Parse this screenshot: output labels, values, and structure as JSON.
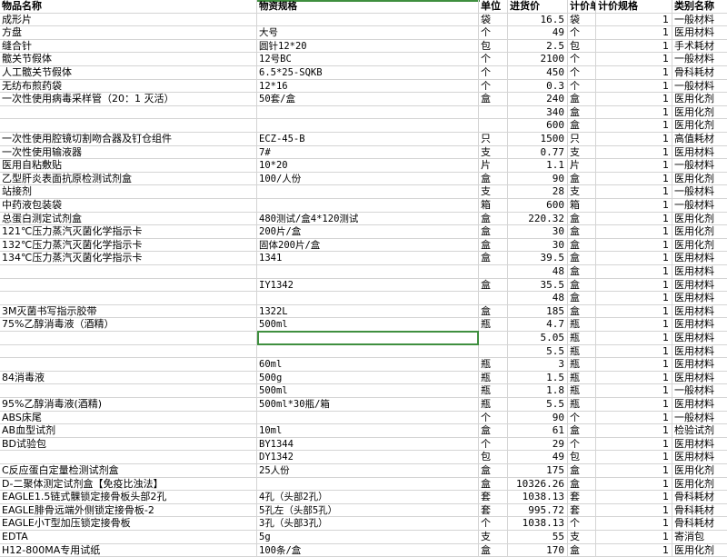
{
  "headers": {
    "name": "物品名称",
    "spec": "物资规格",
    "unit": "单位",
    "price": "进货价",
    "price_unit": "计价单位",
    "price_spec": "计价规格",
    "category": "类别名称"
  },
  "rows": [
    {
      "name": "成形片",
      "spec": "",
      "unit": "袋",
      "price": "16.5",
      "price_unit": "袋",
      "price_spec": "1",
      "category": "一般材料"
    },
    {
      "name": "方盘",
      "spec": "大号",
      "unit": "个",
      "price": "49",
      "price_unit": "个",
      "price_spec": "1",
      "category": "医用材料"
    },
    {
      "name": "缝合针",
      "spec": "圆针12*20",
      "unit": "包",
      "price": "2.5",
      "price_unit": "包",
      "price_spec": "1",
      "category": "手术耗材"
    },
    {
      "name": "髋关节假体",
      "spec": "12号BC",
      "unit": "个",
      "price": "2100",
      "price_unit": "个",
      "price_spec": "1",
      "category": "一般材料"
    },
    {
      "name": "人工髋关节假体",
      "spec": "6.5*25-SQKB",
      "unit": "个",
      "price": "450",
      "price_unit": "个",
      "price_spec": "1",
      "category": "骨科耗材"
    },
    {
      "name": "无纺布煎药袋",
      "spec": "12*16",
      "unit": "个",
      "price": "0.3",
      "price_unit": "个",
      "price_spec": "1",
      "category": "一般材料"
    },
    {
      "name": "一次性使用病毒采样管（20：1 灭活）",
      "spec": "50套/盒",
      "unit": "盒",
      "price": "240",
      "price_unit": "盒",
      "price_spec": "1",
      "category": "医用化剂"
    },
    {
      "name": "",
      "spec": "",
      "unit": "",
      "price": "340",
      "price_unit": "盒",
      "price_spec": "1",
      "category": "医用化剂"
    },
    {
      "name": "",
      "spec": "",
      "unit": "",
      "price": "600",
      "price_unit": "盒",
      "price_spec": "1",
      "category": "医用化剂"
    },
    {
      "name": "一次性使用腔镜切割吻合器及钉仓组件",
      "spec": "ECZ-45-B",
      "unit": "只",
      "price": "1500",
      "price_unit": "只",
      "price_spec": "1",
      "category": "高值耗材"
    },
    {
      "name": "一次性使用输液器",
      "spec": "7#",
      "unit": "支",
      "price": "0.77",
      "price_unit": "支",
      "price_spec": "1",
      "category": "医用材料"
    },
    {
      "name": "医用自粘敷贴",
      "spec": "10*20",
      "unit": "片",
      "price": "1.1",
      "price_unit": "片",
      "price_spec": "1",
      "category": "一般材料"
    },
    {
      "name": "乙型肝炎表面抗原检测试剂盒",
      "spec": "100/人份",
      "unit": "盒",
      "price": "90",
      "price_unit": "盒",
      "price_spec": "1",
      "category": "医用化剂"
    },
    {
      "name": "站接剂",
      "spec": "",
      "unit": "支",
      "price": "28",
      "price_unit": "支",
      "price_spec": "1",
      "category": "一般材料"
    },
    {
      "name": "中药液包装袋",
      "spec": "",
      "unit": "箱",
      "price": "600",
      "price_unit": "箱",
      "price_spec": "1",
      "category": "一般材料"
    },
    {
      "name": "总蛋白测定试剂盒",
      "spec": "480测试/盒4*120测试",
      "unit": "盒",
      "price": "220.32",
      "price_unit": "盒",
      "price_spec": "1",
      "category": "医用化剂"
    },
    {
      "name": "121℃压力蒸汽灭菌化学指示卡",
      "spec": "200片/盒",
      "unit": "盒",
      "price": "30",
      "price_unit": "盒",
      "price_spec": "1",
      "category": "医用化剂"
    },
    {
      "name": "132℃压力蒸汽灭菌化学指示卡",
      "spec": "固体200片/盒",
      "unit": "盒",
      "price": "30",
      "price_unit": "盒",
      "price_spec": "1",
      "category": "医用化剂"
    },
    {
      "name": "134℃压力蒸汽灭菌化学指示卡",
      "spec": "1341",
      "unit": "盒",
      "price": "39.5",
      "price_unit": "盒",
      "price_spec": "1",
      "category": "医用材料"
    },
    {
      "name": "",
      "spec": "",
      "unit": "",
      "price": "48",
      "price_unit": "盒",
      "price_spec": "1",
      "category": "医用材料"
    },
    {
      "name": "",
      "spec": "IY1342",
      "unit": "盒",
      "price": "35.5",
      "price_unit": "盒",
      "price_spec": "1",
      "category": "医用材料"
    },
    {
      "name": "",
      "spec": "",
      "unit": "",
      "price": "48",
      "price_unit": "盒",
      "price_spec": "1",
      "category": "医用材料"
    },
    {
      "name": "3M灭菌书写指示胶带",
      "spec": "1322L",
      "unit": "盒",
      "price": "185",
      "price_unit": "盒",
      "price_spec": "1",
      "category": "医用材料"
    },
    {
      "name": "75%乙醇消毒液（酒精）",
      "spec": "500ml",
      "unit": "瓶",
      "price": "4.7",
      "price_unit": "瓶",
      "price_spec": "1",
      "category": "医用材料"
    },
    {
      "name": "",
      "spec": "",
      "unit": "",
      "price": "5.05",
      "price_unit": "瓶",
      "price_spec": "1",
      "category": "医用材料"
    },
    {
      "name": "",
      "spec": "",
      "unit": "",
      "price": "5.5",
      "price_unit": "瓶",
      "price_spec": "1",
      "category": "医用材料"
    },
    {
      "name": "",
      "spec": "60ml",
      "unit": "瓶",
      "price": "3",
      "price_unit": "瓶",
      "price_spec": "1",
      "category": "医用材料"
    },
    {
      "name": "84消毒液",
      "spec": "500g",
      "unit": "瓶",
      "price": "1.5",
      "price_unit": "瓶",
      "price_spec": "1",
      "category": "医用材料"
    },
    {
      "name": "",
      "spec": "500ml",
      "unit": "瓶",
      "price": "1.8",
      "price_unit": "瓶",
      "price_spec": "1",
      "category": "一般材料"
    },
    {
      "name": "95%乙醇消毒液(酒精)",
      "spec": "500ml*30瓶/箱",
      "unit": "瓶",
      "price": "5.5",
      "price_unit": "瓶",
      "price_spec": "1",
      "category": "医用材料"
    },
    {
      "name": "ABS床尾",
      "spec": "",
      "unit": "个",
      "price": "90",
      "price_unit": "个",
      "price_spec": "1",
      "category": "一般材料"
    },
    {
      "name": "AB血型试剂",
      "spec": "10ml",
      "unit": "盒",
      "price": "61",
      "price_unit": "盒",
      "price_spec": "1",
      "category": "检验试剂"
    },
    {
      "name": "BD试验包",
      "spec": "BY1344",
      "unit": "个",
      "price": "29",
      "price_unit": "个",
      "price_spec": "1",
      "category": "医用材料"
    },
    {
      "name": "",
      "spec": "DY1342",
      "unit": "包",
      "price": "49",
      "price_unit": "包",
      "price_spec": "1",
      "category": "医用材料"
    },
    {
      "name": "C反应蛋白定量检测试剂盒",
      "spec": "25人份",
      "unit": "盒",
      "price": "175",
      "price_unit": "盒",
      "price_spec": "1",
      "category": "医用化剂"
    },
    {
      "name": "D-二聚体测定试剂盒【免疫比浊法】",
      "spec": "",
      "unit": "盒",
      "price": "10326.26",
      "price_unit": "盒",
      "price_spec": "1",
      "category": "医用化剂"
    },
    {
      "name": "EAGLE1.5链式髁锁定接骨板头部2孔",
      "spec": "4孔（头部2孔）",
      "unit": "套",
      "price": "1038.13",
      "price_unit": "套",
      "price_spec": "1",
      "category": "骨科耗材"
    },
    {
      "name": "EAGLE腓骨远端外侧锁定接骨板-2",
      "spec": "5孔左（头部5孔）",
      "unit": "套",
      "price": "995.72",
      "price_unit": "套",
      "price_spec": "1",
      "category": "骨科耗材"
    },
    {
      "name": "EAGLE小T型加压锁定接骨板",
      "spec": "3孔（头部3孔）",
      "unit": "个",
      "price": "1038.13",
      "price_unit": "个",
      "price_spec": "1",
      "category": "骨科耗材"
    },
    {
      "name": "EDTA",
      "spec": "5g",
      "unit": "支",
      "price": "55",
      "price_unit": "支",
      "price_spec": "1",
      "category": "寄消包"
    },
    {
      "name": "H12-800MA专用试纸",
      "spec": "100条/盒",
      "unit": "盒",
      "price": "170",
      "price_unit": "盒",
      "price_spec": "1",
      "category": "医用化剂"
    }
  ]
}
